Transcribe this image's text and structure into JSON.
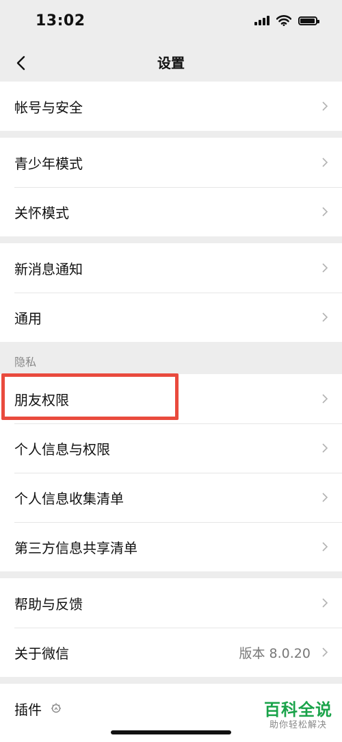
{
  "status_bar": {
    "time": "13:02"
  },
  "nav": {
    "title": "设置"
  },
  "groups": [
    {
      "items": [
        {
          "label": "帐号与安全"
        }
      ]
    },
    {
      "items": [
        {
          "label": "青少年模式"
        },
        {
          "label": "关怀模式"
        }
      ]
    },
    {
      "items": [
        {
          "label": "新消息通知"
        },
        {
          "label": "通用"
        }
      ]
    },
    {
      "header": "隐私",
      "items": [
        {
          "label": "朋友权限",
          "highlighted": true
        },
        {
          "label": "个人信息与权限"
        },
        {
          "label": "个人信息收集清单"
        },
        {
          "label": "第三方信息共享清单"
        }
      ]
    },
    {
      "items": [
        {
          "label": "帮助与反馈"
        },
        {
          "label": "关于微信",
          "value": "版本 8.0.20"
        }
      ]
    },
    {
      "items": [
        {
          "label": "插件",
          "icon": "plugin-bulb-icon"
        }
      ]
    }
  ],
  "watermark": {
    "main": "百科全说",
    "sub": "助你轻松解决"
  },
  "colors": {
    "background": "#ededed",
    "highlight_border": "#e94a3d",
    "watermark_green": "#1aa34a"
  }
}
